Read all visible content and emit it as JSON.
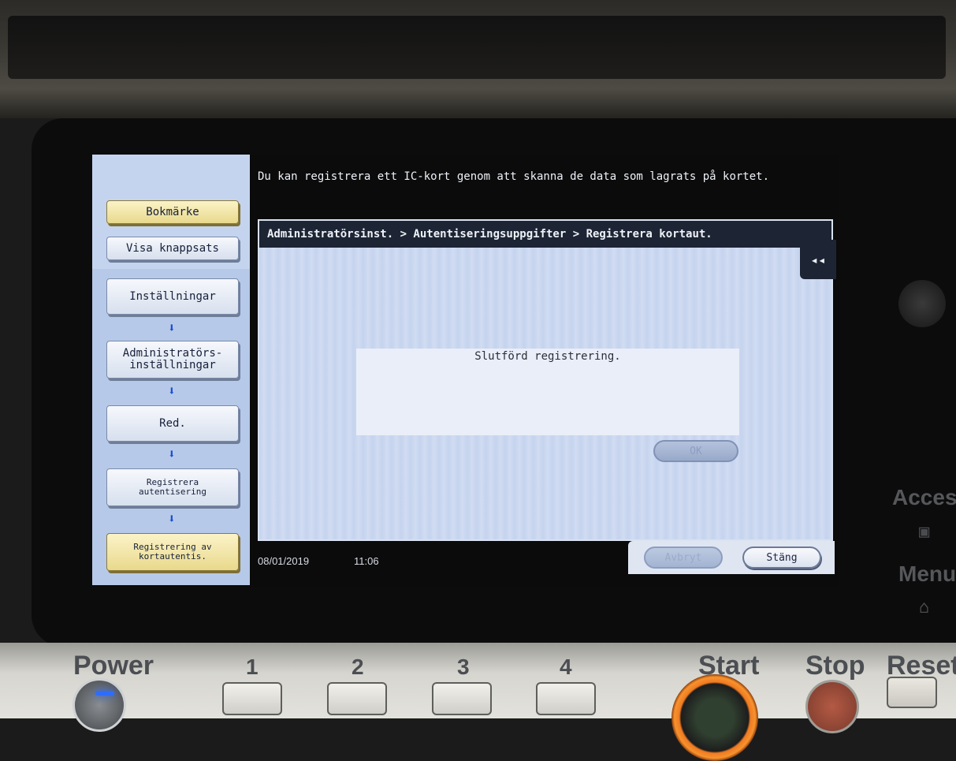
{
  "device": {
    "side_labels": {
      "access": "Access",
      "menu": "Menu"
    },
    "panel_labels": {
      "power": "Power",
      "key1": "1",
      "key2": "2",
      "key3": "3",
      "key4": "4",
      "start": "Start",
      "stop": "Stop",
      "reset": "Reset"
    }
  },
  "screen": {
    "info_text": "Du kan registrera ett IC-kort genom att skanna de data som lagrats på kortet.",
    "nav": {
      "bookmark": "Bokmärke",
      "show_keypad": "Visa knappsats",
      "steps": [
        "Inställningar",
        "Administratörs-\ninställningar",
        "Red.",
        "Registrera\nautentisering",
        "Registrering av\nkortautentis."
      ]
    },
    "breadcrumb": "Administratörsinst. > Autentiseringsuppgifter > Registrera kortaut.",
    "collapse_icon": "◂◂",
    "dialog": {
      "message": "Slutförd registrering.",
      "ok_label": "OK"
    },
    "status": {
      "date": "08/01/2019",
      "time": "11:06"
    },
    "actions": {
      "cancel_label": "Avbryt",
      "close_label": "Stäng"
    }
  }
}
